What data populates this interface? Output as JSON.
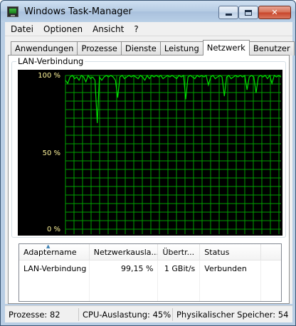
{
  "window": {
    "title": "Windows Task-Manager",
    "minimize_label": "",
    "maximize_label": "",
    "close_label": "✕"
  },
  "menu": [
    "Datei",
    "Optionen",
    "Ansicht",
    "?"
  ],
  "tabs": [
    {
      "label": "Anwendungen",
      "active": false
    },
    {
      "label": "Prozesse",
      "active": false
    },
    {
      "label": "Dienste",
      "active": false
    },
    {
      "label": "Leistung",
      "active": false
    },
    {
      "label": "Netzwerk",
      "active": true
    },
    {
      "label": "Benutzer",
      "active": false
    }
  ],
  "graph": {
    "title": "LAN-Verbindung",
    "y_labels": [
      "100 %",
      "50 %",
      "0 %"
    ],
    "line_color": "#00e000",
    "grid_color": "#00a000"
  },
  "chart_data": {
    "type": "line",
    "y_unit": "%",
    "ylim": [
      0,
      100
    ],
    "grid": true,
    "series": [
      {
        "values": [
          97,
          95,
          99,
          100,
          98,
          99,
          97,
          100,
          99,
          96,
          100,
          98,
          99,
          97,
          70,
          99,
          97,
          99,
          100,
          99,
          100,
          99,
          97,
          86,
          99,
          100,
          98,
          99,
          100,
          99,
          100,
          99,
          98,
          100,
          99,
          97,
          100,
          98,
          100,
          99,
          100,
          99,
          100,
          98,
          99,
          100,
          99,
          100,
          99,
          98,
          100,
          99,
          100,
          85,
          99,
          100,
          99,
          98,
          100,
          99,
          100,
          99,
          100,
          94,
          99,
          100,
          98,
          99,
          100,
          99,
          87,
          99,
          100,
          98,
          99,
          100,
          99,
          100,
          99,
          100,
          91,
          99,
          100,
          99,
          89,
          99,
          100,
          99,
          100,
          98,
          100,
          95,
          100,
          99,
          100,
          99
        ]
      }
    ]
  },
  "table": {
    "columns": [
      "Adaptername",
      "Netzwerkausla...",
      "Übertr...",
      "Status",
      ""
    ],
    "rows": [
      {
        "adapter": "LAN-Verbindung",
        "utilization": "99,15 %",
        "speed": "1 GBit/s",
        "status": "Verbunden"
      }
    ]
  },
  "statusbar": {
    "processes": "Prozesse: 82",
    "cpu": "CPU-Auslastung: 45%",
    "memory": "Physikalischer Speicher: 54"
  }
}
